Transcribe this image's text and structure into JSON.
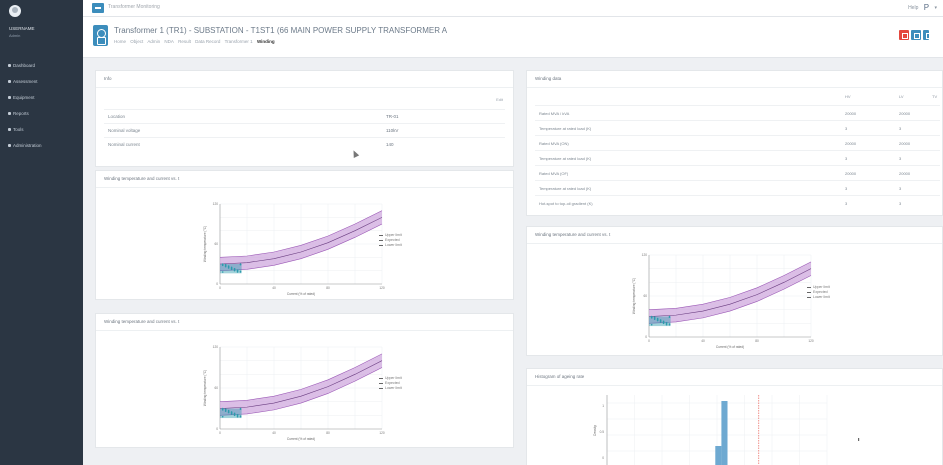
{
  "sidebar": {
    "user_name": "USERNAME",
    "user_role": "Admin",
    "items": [
      {
        "label": "Dashboard",
        "icon": "dashboard-icon"
      },
      {
        "label": "Assessment",
        "icon": "assessment-icon"
      },
      {
        "label": "Equipment",
        "icon": "equipment-icon"
      },
      {
        "label": "Reports",
        "icon": "reports-icon"
      },
      {
        "label": "Tools",
        "icon": "tools-icon"
      },
      {
        "label": "Administration",
        "icon": "admin-icon"
      }
    ]
  },
  "topbar": {
    "breadcrumb": "Transformer Monitoring",
    "right_text": "Help",
    "right_letter": "P"
  },
  "header": {
    "title": "Transformer 1 (TR1) - SUBSTATION  -  T1ST1 (66 MAIN POWER SUPPLY TRANSFORMER A",
    "links": [
      {
        "label": "Home",
        "active": false
      },
      {
        "label": "Object",
        "active": false
      },
      {
        "label": "Admin",
        "active": false
      },
      {
        "label": "NDA",
        "active": false
      },
      {
        "label": "Result",
        "active": false
      },
      {
        "label": "Data Record",
        "active": false
      },
      {
        "label": "Transformer 1",
        "active": false
      },
      {
        "label": "Winding",
        "active": true
      }
    ]
  },
  "info_panel": {
    "title": "Info",
    "link": "Edit",
    "rows": [
      {
        "label": "Location",
        "value": "TR-01"
      },
      {
        "label": "Nominal voltage",
        "value": "110kV"
      },
      {
        "label": "Nominal current",
        "value": "140"
      }
    ]
  },
  "ratings_panel": {
    "title": "Winding data",
    "columns": [
      "HV",
      "LV",
      "TV"
    ],
    "rows": [
      {
        "label": "Rated MVA / kVA",
        "values": [
          "20000",
          "20000",
          ""
        ]
      },
      {
        "label": "Temperature at rated load (K)",
        "values": [
          "3",
          "3",
          ""
        ]
      },
      {
        "label": "Rated MVA (ON)",
        "values": [
          "20000",
          "20000",
          ""
        ]
      },
      {
        "label": "Temperature at rated load (K)",
        "values": [
          "3",
          "3",
          ""
        ]
      },
      {
        "label": "Rated MVA (OF)",
        "values": [
          "20000",
          "20000",
          ""
        ]
      },
      {
        "label": "Temperature at rated load (K)",
        "values": [
          "3",
          "3",
          ""
        ]
      },
      {
        "label": "Hot-spot to top-oil gradient (K)",
        "values": [
          "3",
          "3",
          ""
        ]
      }
    ]
  },
  "chart_panels": {
    "left_top": {
      "title": "Winding temperature and current vs. t"
    },
    "left_bottom": {
      "title": "Winding temperature and current vs. t"
    },
    "right_mid": {
      "title": "Winding temperature and current vs. t"
    },
    "right_bottom": {
      "title": "Histogram of ageing rate"
    }
  },
  "chart_data": [
    {
      "type": "line",
      "title": "",
      "xlabel": "Current (% of rated)",
      "ylabel": "Winding temperature (°C)",
      "x": [
        0,
        20,
        40,
        60,
        80,
        100,
        120
      ],
      "series": [
        {
          "name": "Upper limit",
          "values": [
            40,
            42,
            48,
            58,
            72,
            90,
            110
          ]
        },
        {
          "name": "Expected",
          "values": [
            30,
            32,
            38,
            48,
            62,
            80,
            100
          ]
        },
        {
          "name": "Lower limit",
          "values": [
            20,
            22,
            28,
            38,
            52,
            70,
            90
          ]
        }
      ],
      "ylim": [
        0,
        120
      ],
      "xlim": [
        0,
        120
      ],
      "grid": true,
      "legend": "right",
      "colors": {
        "band": "#c9a4d9",
        "line": "#9b59b6",
        "points": "#2e9cad"
      }
    },
    {
      "type": "line",
      "title": "",
      "xlabel": "Current (% of rated)",
      "ylabel": "Winding temperature (°C)",
      "x": [
        0,
        20,
        40,
        60,
        80,
        100,
        120
      ],
      "series": [
        {
          "name": "Upper limit",
          "values": [
            40,
            42,
            48,
            58,
            72,
            90,
            110
          ]
        },
        {
          "name": "Expected",
          "values": [
            30,
            32,
            38,
            48,
            62,
            80,
            100
          ]
        },
        {
          "name": "Lower limit",
          "values": [
            20,
            22,
            28,
            38,
            52,
            70,
            90
          ]
        }
      ],
      "ylim": [
        0,
        120
      ],
      "xlim": [
        0,
        120
      ],
      "grid": true,
      "legend": "right"
    },
    {
      "type": "line",
      "title": "",
      "xlabel": "Current (% of rated)",
      "ylabel": "Winding temperature (°C)",
      "x": [
        0,
        20,
        40,
        60,
        80,
        100,
        120
      ],
      "series": [
        {
          "name": "Upper limit",
          "values": [
            40,
            42,
            48,
            58,
            72,
            90,
            110
          ]
        },
        {
          "name": "Expected",
          "values": [
            30,
            32,
            38,
            48,
            62,
            80,
            100
          ]
        },
        {
          "name": "Lower limit",
          "values": [
            20,
            22,
            28,
            38,
            52,
            70,
            90
          ]
        }
      ],
      "ylim": [
        0,
        120
      ],
      "xlim": [
        0,
        120
      ],
      "grid": true,
      "legend": "right"
    },
    {
      "type": "bar",
      "title": "",
      "xlabel": "",
      "ylabel": "Density",
      "categories": [
        "0.0",
        "0.5",
        "1.0",
        "1.5",
        "2.0",
        "2.5"
      ],
      "values": [
        0,
        0,
        0.4,
        1.0,
        0,
        0
      ],
      "ylim": [
        0,
        1
      ],
      "grid": true,
      "legend": "right",
      "colors": {
        "bar": "#6ea9d1",
        "reference_line": "#e4483e"
      }
    }
  ]
}
